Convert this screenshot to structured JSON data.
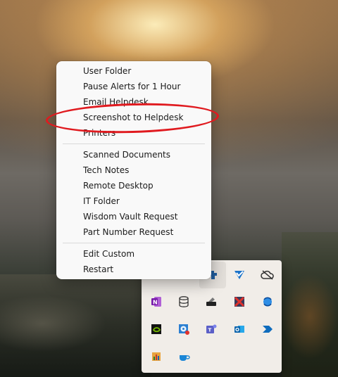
{
  "menu": {
    "items": [
      {
        "label": "User Folder"
      },
      {
        "label": "Pause Alerts for 1 Hour"
      },
      {
        "label": "Email Helpdesk"
      },
      {
        "label": "Screenshot to Helpdesk"
      },
      {
        "label": "Printers"
      },
      {
        "label": "Scanned Documents"
      },
      {
        "label": "Tech Notes"
      },
      {
        "label": "Remote Desktop"
      },
      {
        "label": "IT Folder"
      },
      {
        "label": "Wisdom Vault Request"
      },
      {
        "label": "Part Number Request"
      },
      {
        "label": "Edit Custom"
      },
      {
        "label": "Restart"
      }
    ],
    "highlighted_item": "Screenshot to Helpdesk"
  },
  "tray": {
    "icons": [
      "puzzle-agent-icon",
      "check-shield-icon",
      "cloud-slash-icon",
      "onenote-icon",
      "database-drive-icon",
      "backup-drive-icon",
      "red-x-box-icon",
      "sync-globe-icon",
      "nvidia-icon",
      "disc-alert-icon",
      "teams-new-icon",
      "outlook-new-icon",
      "power-automate-icon",
      "colored-app-icon",
      "cup-icon"
    ]
  },
  "colors": {
    "annotation": "#e01a1f",
    "menu_bg": "#f9f9f9",
    "tray_bg": "#f1ede8"
  }
}
